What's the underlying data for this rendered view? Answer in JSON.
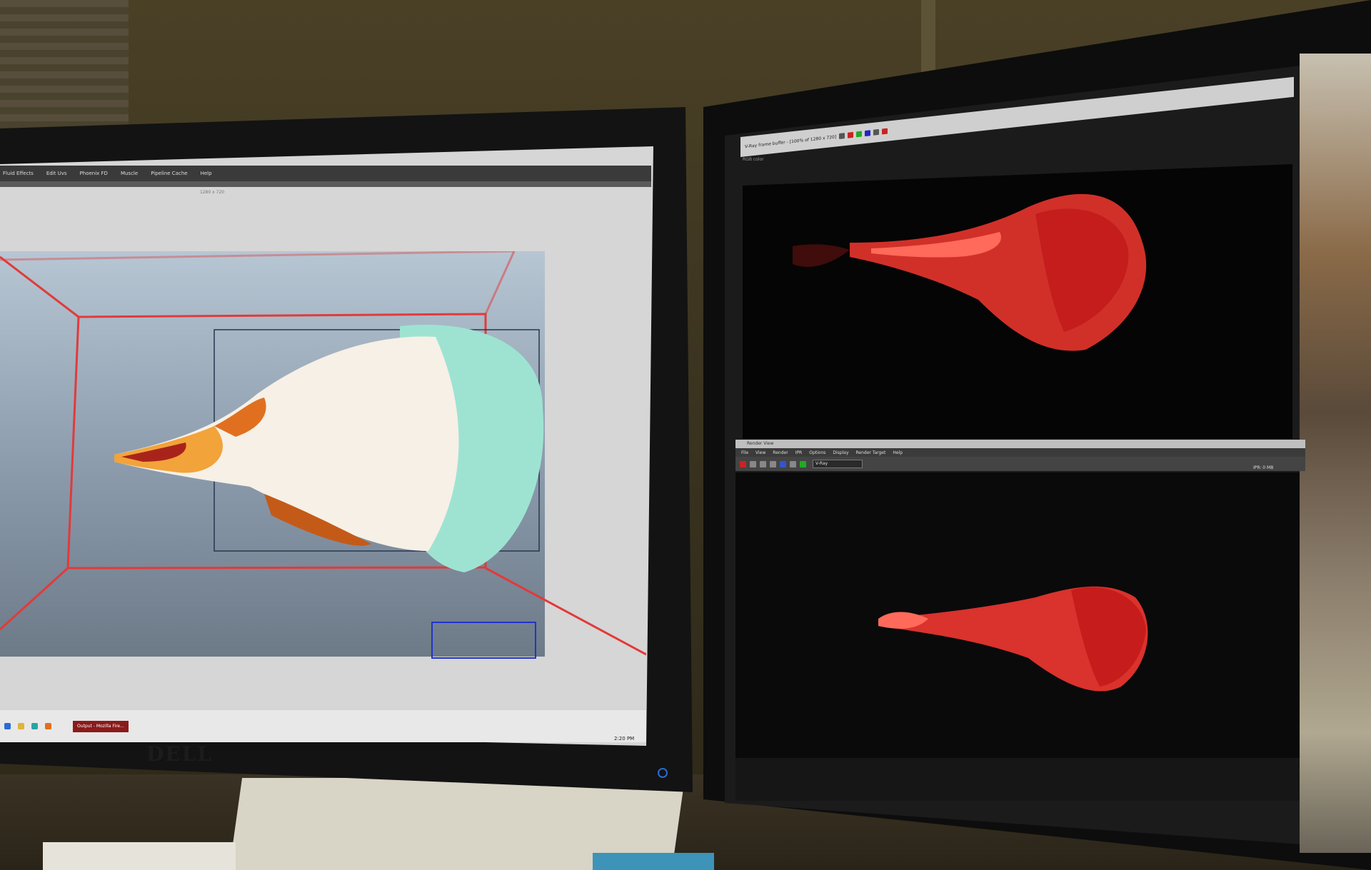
{
  "left_monitor": {
    "brand": "DELL",
    "maya": {
      "menu": [
        "Fluid Effects",
        "Edit Uvs",
        "Phoenix FD",
        "Muscle",
        "Pipeline Cache",
        "Help"
      ],
      "viewport_label": "1280 x 720"
    },
    "taskbar": {
      "app_label": "Output - Mozilla Fire...",
      "clock": "2:20 PM"
    },
    "colors": {
      "grid": "#e23a3a",
      "voxel_light": "#9ee3d2",
      "voxel_fire": "#f2a33a"
    }
  },
  "right_monitor": {
    "vfb": {
      "title": "V-Ray frame buffer - [100% of 1280 x 720]",
      "channel": "RGB color"
    },
    "render_view": {
      "title": "Render View",
      "menu": [
        "File",
        "View",
        "Render",
        "IPR",
        "Options",
        "Display",
        "Render Target",
        "Help"
      ],
      "renderer": "V-Ray",
      "status": "IPR: 0 MB"
    },
    "colors": {
      "flame": "#ff3a32"
    }
  }
}
